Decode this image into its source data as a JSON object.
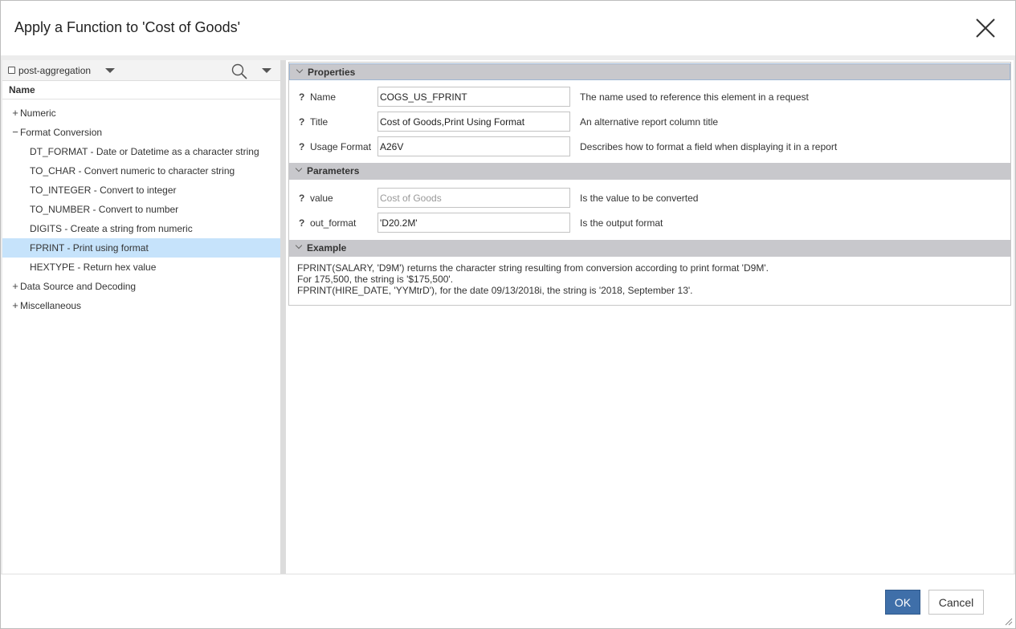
{
  "dialog": {
    "title": "Apply a Function to 'Cost of Goods'",
    "close_icon": "close-icon"
  },
  "left": {
    "mode_label": "post-aggregation",
    "column_header": "Name",
    "tree": [
      {
        "label": "Numeric",
        "toggle": "+",
        "level": 0
      },
      {
        "label": "Format Conversion",
        "toggle": "−",
        "level": 0
      },
      {
        "label": "DT_FORMAT - Date or Datetime as a character string",
        "toggle": "",
        "level": 1
      },
      {
        "label": "TO_CHAR - Convert numeric to character string",
        "toggle": "",
        "level": 1
      },
      {
        "label": "TO_INTEGER - Convert to integer",
        "toggle": "",
        "level": 1
      },
      {
        "label": "TO_NUMBER - Convert to number",
        "toggle": "",
        "level": 1
      },
      {
        "label": "DIGITS - Create a string from numeric",
        "toggle": "",
        "level": 1
      },
      {
        "label": "FPRINT - Print using format",
        "toggle": "",
        "level": 1,
        "selected": true
      },
      {
        "label": "HEXTYPE - Return hex value",
        "toggle": "",
        "level": 1
      },
      {
        "label": "Data Source and Decoding",
        "toggle": "+",
        "level": 0
      },
      {
        "label": "Miscellaneous",
        "toggle": "+",
        "level": 0
      }
    ]
  },
  "properties": {
    "section_title": "Properties",
    "rows": [
      {
        "help": "?",
        "label": "Name",
        "value": "COGS_US_FPRINT",
        "desc": "The name used to reference this element in a request"
      },
      {
        "help": "?",
        "label": "Title",
        "value": "Cost of Goods,Print Using Format",
        "desc": "An alternative report column title"
      },
      {
        "help": "?",
        "label": "Usage Format",
        "value": "A26V",
        "desc": "Describes how to format a field when displaying it in a report"
      }
    ]
  },
  "parameters": {
    "section_title": "Parameters",
    "rows": [
      {
        "help": "?",
        "label": "value",
        "value": "Cost of Goods",
        "desc": "Is the value to be converted",
        "disabled": true
      },
      {
        "help": "?",
        "label": "out_format",
        "value": "'D20.2M'",
        "desc": "Is the output format"
      }
    ]
  },
  "example": {
    "section_title": "Example",
    "lines": [
      "FPRINT(SALARY, 'D9M') returns the character string resulting from conversion according to print format 'D9M'.",
      "For 175,500, the string is '$175,500'.",
      "FPRINT(HIRE_DATE, 'YYMtrD'), for the date 09/13/2018i, the string is '2018, September 13'."
    ]
  },
  "footer": {
    "ok_label": "OK",
    "cancel_label": "Cancel"
  }
}
